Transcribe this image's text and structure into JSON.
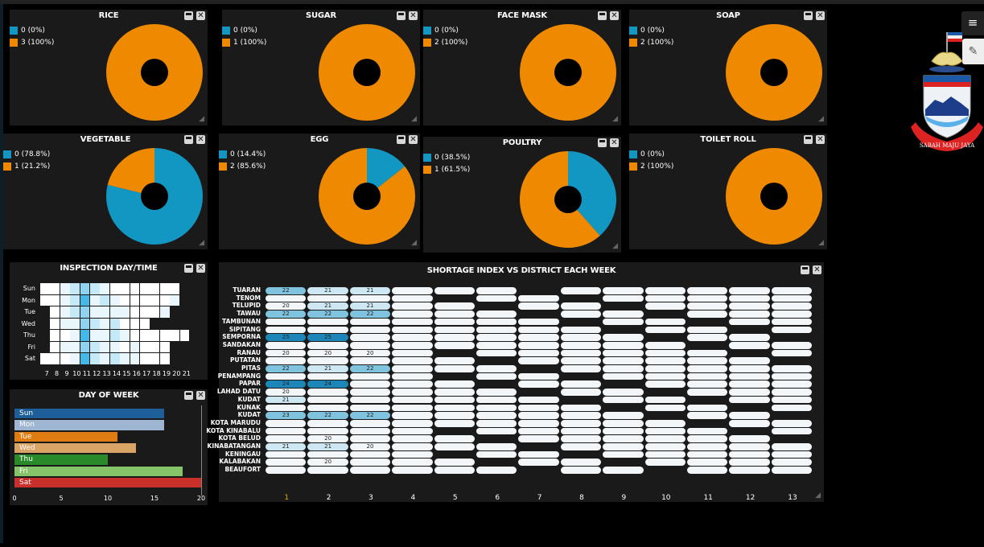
{
  "colors": {
    "blue": "#1197c2",
    "orange": "#ef8a00",
    "panel": "#1a1a1a"
  },
  "pies": [
    {
      "id": "rice",
      "title": "RICE",
      "legend": [
        "0 (0%)",
        "3 (100%)"
      ],
      "blue_fraction": 0
    },
    {
      "id": "sugar",
      "title": "SUGAR",
      "legend": [
        "0 (0%)",
        "1 (100%)"
      ],
      "blue_fraction": 0
    },
    {
      "id": "facemask",
      "title": "FACE MASK",
      "legend": [
        "0 (0%)",
        "2 (100%)"
      ],
      "blue_fraction": 0
    },
    {
      "id": "soap",
      "title": "SOAP",
      "legend": [
        "0 (0%)",
        "2 (100%)"
      ],
      "blue_fraction": 0
    },
    {
      "id": "vegetable",
      "title": "VEGETABLE",
      "legend": [
        "0 (78.8%)",
        "1 (21.2%)"
      ],
      "blue_fraction": 0.788
    },
    {
      "id": "egg",
      "title": "EGG",
      "legend": [
        "0 (14.4%)",
        "2 (85.6%)"
      ],
      "blue_fraction": 0.144
    },
    {
      "id": "poultry",
      "title": "POULTRY",
      "legend": [
        "0 (38.5%)",
        "1 (61.5%)"
      ],
      "blue_fraction": 0.385
    },
    {
      "id": "toiletroll",
      "title": "TOILET ROLL",
      "legend": [
        "0 (0%)",
        "2 (100%)"
      ],
      "blue_fraction": 0
    }
  ],
  "heatmap": {
    "title": "INSPECTION DAY/TIME",
    "days": [
      "Sun",
      "Mon",
      "Tue",
      "Wed",
      "Thu",
      "Fri",
      "Sat"
    ],
    "hours": [
      "7",
      "8",
      "9",
      "10",
      "11",
      "12",
      "13",
      "14",
      "15",
      "16",
      "17",
      "18",
      "19",
      "20",
      "21"
    ]
  },
  "dow": {
    "title": "DAY OF WEEK",
    "bars": [
      {
        "label": "Sun",
        "value": 16,
        "color": "#1f5f99"
      },
      {
        "label": "Mon",
        "value": 16,
        "color": "#9fb6d2"
      },
      {
        "label": "Tue",
        "value": 11,
        "color": "#e07d12"
      },
      {
        "label": "Wed",
        "value": 13,
        "color": "#d9a466"
      },
      {
        "label": "Thu",
        "value": 10,
        "color": "#2a8a2a"
      },
      {
        "label": "Fri",
        "value": 18,
        "color": "#86c46a"
      },
      {
        "label": "Sat",
        "value": 20,
        "color": "#c9302c"
      }
    ],
    "ticks": [
      "0",
      "5",
      "10",
      "15",
      "20"
    ],
    "max": 20
  },
  "shortage": {
    "title": "SHORTAGE INDEX VS DISTRICT EACH WEEK",
    "districts": [
      "TUARAN",
      "TENOM",
      "TELUPID",
      "TAWAU",
      "TAMBUNAN",
      "SIPITANG",
      "SEMPORNA",
      "SANDAKAN",
      "RANAU",
      "PUTATAN",
      "PITAS",
      "PENAMPANG",
      "PAPAR",
      "LAHAD DATU",
      "KUDAT",
      "KUNAK",
      "KUDAT",
      "KOTA MARUDU",
      "KOTA KINABALU",
      "KOTA BELUD",
      "KINABATANGAN",
      "KENINGAU",
      "KALABAKAN",
      "BEAUFORT"
    ],
    "weeks": [
      "1",
      "2",
      "3",
      "4",
      "5",
      "6",
      "7",
      "8",
      "9",
      "10",
      "11",
      "12",
      "13"
    ],
    "cells": [
      {
        "r": 0,
        "c": 0,
        "t": "22"
      },
      {
        "r": 0,
        "c": 1,
        "t": "21"
      },
      {
        "r": 0,
        "c": 2,
        "t": "21"
      },
      {
        "r": 2,
        "c": 0,
        "t": "20"
      },
      {
        "r": 2,
        "c": 1,
        "t": "21"
      },
      {
        "r": 2,
        "c": 2,
        "t": "21"
      },
      {
        "r": 3,
        "c": 0,
        "t": "22"
      },
      {
        "r": 3,
        "c": 1,
        "t": "22"
      },
      {
        "r": 3,
        "c": 2,
        "t": "22"
      },
      {
        "r": 6,
        "c": 0,
        "t": "25"
      },
      {
        "r": 6,
        "c": 1,
        "t": "25"
      },
      {
        "r": 8,
        "c": 0,
        "t": "20"
      },
      {
        "r": 8,
        "c": 1,
        "t": "20"
      },
      {
        "r": 8,
        "c": 2,
        "t": "20"
      },
      {
        "r": 10,
        "c": 0,
        "t": "22"
      },
      {
        "r": 10,
        "c": 1,
        "t": "21"
      },
      {
        "r": 10,
        "c": 2,
        "t": "22"
      },
      {
        "r": 12,
        "c": 0,
        "t": "24"
      },
      {
        "r": 12,
        "c": 1,
        "t": "24"
      },
      {
        "r": 13,
        "c": 0,
        "t": "20"
      },
      {
        "r": 14,
        "c": 0,
        "t": "21"
      },
      {
        "r": 16,
        "c": 0,
        "t": "23"
      },
      {
        "r": 16,
        "c": 1,
        "t": "22"
      },
      {
        "r": 16,
        "c": 2,
        "t": "22"
      },
      {
        "r": 19,
        "c": 1,
        "t": "20"
      },
      {
        "r": 20,
        "c": 0,
        "t": "21"
      },
      {
        "r": 20,
        "c": 1,
        "t": "21"
      },
      {
        "r": 20,
        "c": 2,
        "t": "20"
      },
      {
        "r": 22,
        "c": 1,
        "t": "20"
      }
    ]
  },
  "logo": {
    "motto": "SABAH MAJU JAYA"
  },
  "menu": {
    "icon": "≡",
    "tool_icon": "✎"
  }
}
